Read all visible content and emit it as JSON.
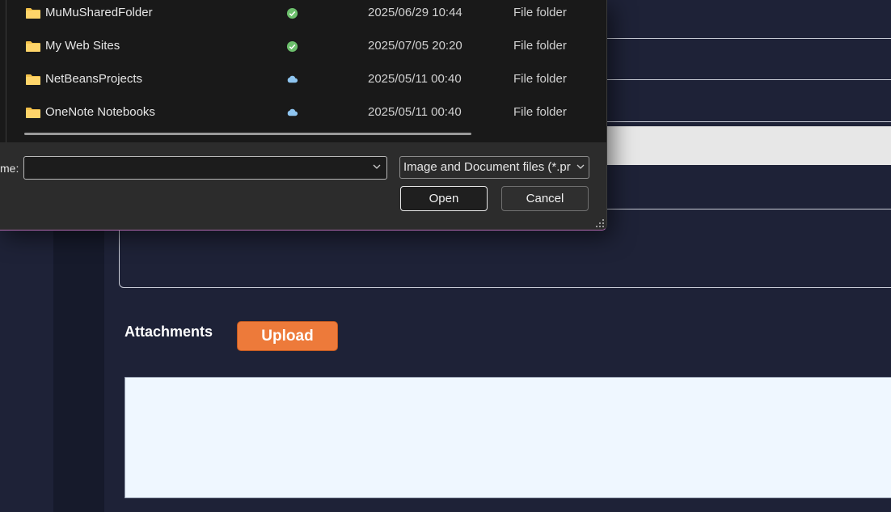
{
  "page": {
    "attachments_label": "Attachments",
    "upload_label": "Upload"
  },
  "dialog": {
    "files": [
      {
        "name": "MuMuSharedFolder",
        "status": "synced",
        "date": "2025/06/29 10:44",
        "type": "File folder"
      },
      {
        "name": "My Web Sites",
        "status": "synced",
        "date": "2025/07/05 20:20",
        "type": "File folder"
      },
      {
        "name": "NetBeansProjects",
        "status": "cloud",
        "date": "2025/05/11 00:40",
        "type": "File folder"
      },
      {
        "name": "OneNote Notebooks",
        "status": "cloud",
        "date": "2025/05/11 00:40",
        "type": "File folder"
      }
    ],
    "filename_label": "me:",
    "filename_value": "",
    "filetype_value": "Image and Document files (*.pr",
    "open_label": "Open",
    "cancel_label": "Cancel"
  },
  "colors": {
    "upload_button": "#ed7a3a",
    "synced_icon": "#6cbf6c",
    "cloud_icon": "#8ec5f0",
    "folder_icon": "#f3c14b"
  }
}
